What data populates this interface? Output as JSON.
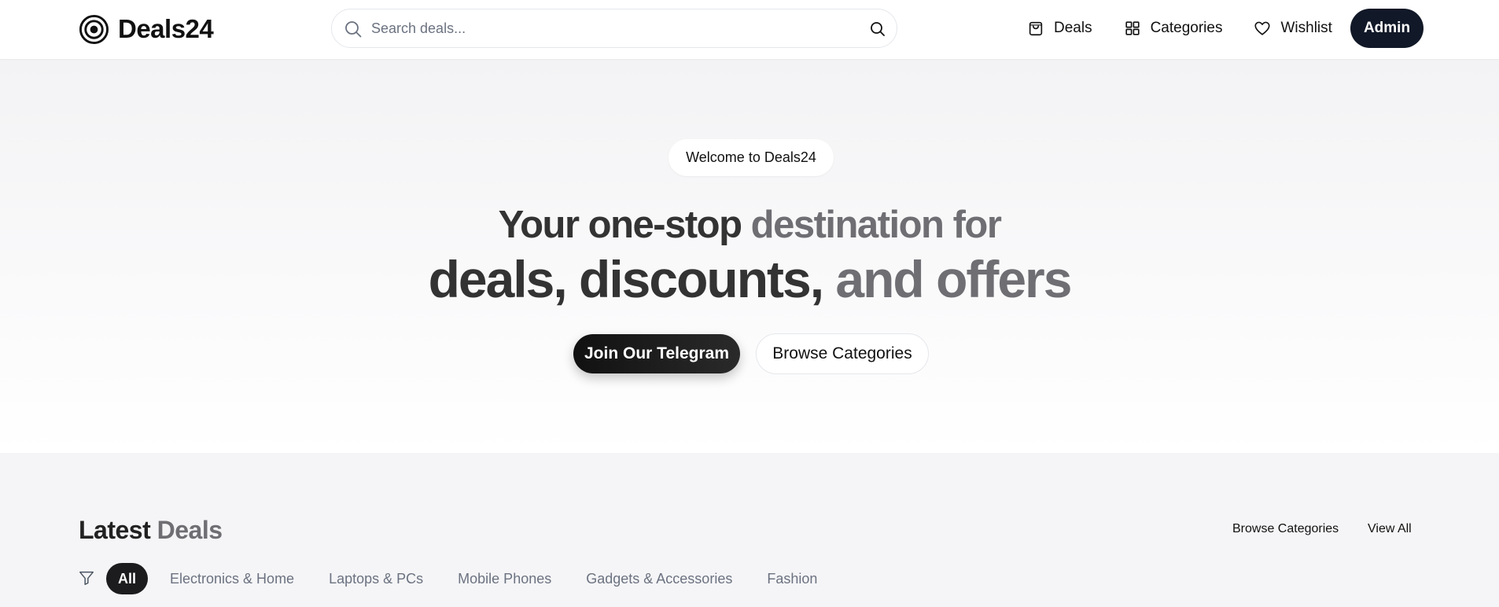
{
  "header": {
    "brand": "Deals24",
    "search_placeholder": "Search deals...",
    "nav": [
      {
        "label": "Deals",
        "icon": "shopping-bag-icon"
      },
      {
        "label": "Categories",
        "icon": "grid-icon"
      },
      {
        "label": "Wishlist",
        "icon": "heart-icon"
      }
    ],
    "admin_label": "Admin"
  },
  "hero": {
    "badge": "Welcome to Deals24",
    "line1_a": "Your one-stop ",
    "line1_b": "destination for",
    "line2_a": "deals, discounts, ",
    "line2_b": "and offers",
    "primary_cta": "Join Our Telegram",
    "secondary_cta": "Browse Categories"
  },
  "latest": {
    "title_a": "Latest",
    "title_b": "Deals",
    "browse_link": "Browse Categories",
    "view_all": "View All",
    "filters": [
      "All",
      "Electronics & Home",
      "Laptops & PCs",
      "Mobile Phones",
      "Gadgets & Accessories",
      "Fashion"
    ],
    "active_filter": "All"
  },
  "colors": {
    "primary_dark": "#111827",
    "accent_grey": "#6e6e73",
    "page_bg": "#f5f5f7"
  }
}
